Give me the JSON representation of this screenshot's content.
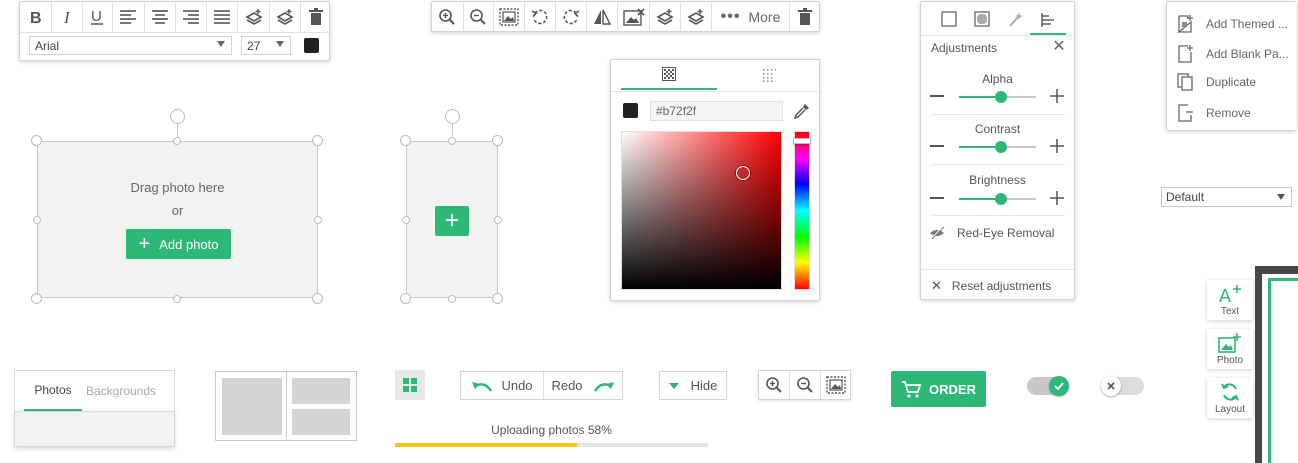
{
  "text_toolbar": {
    "font_family": "Arial",
    "font_size": "27",
    "text_color": "#222222"
  },
  "image_toolbar": {
    "more_label": "More"
  },
  "photo_placeholder": {
    "drag_text": "Drag photo here",
    "or_text": "or",
    "add_photo_label": "Add photo"
  },
  "color_picker": {
    "hex_value": "#b72f2f",
    "current_color": "#222222"
  },
  "adjustments": {
    "title": "Adjustments",
    "alpha_label": "Alpha",
    "contrast_label": "Contrast",
    "brightness_label": "Brightness",
    "alpha_value": 0.55,
    "contrast_value": 0.55,
    "brightness_value": 0.55,
    "red_eye_label": "Red-Eye Removal",
    "reset_label": "Reset adjustments"
  },
  "page_menu": {
    "items": [
      "Add Themed ...",
      "Add Blank Pa...",
      "Duplicate",
      "Remove"
    ]
  },
  "dropdown_default": "Default",
  "side_tools": {
    "text_label": "Text",
    "photo_label": "Photo",
    "layout_label": "Layout"
  },
  "tabs": {
    "photos_label": "Photos",
    "backgrounds_label": "Backgrounds"
  },
  "history": {
    "undo_label": "Undo",
    "redo_label": "Redo"
  },
  "hide_label": "Hide",
  "upload": {
    "text": "Uploading photos 58%",
    "progress": 0.58
  },
  "order_label": "ORDER",
  "colors": {
    "accent": "#2db878",
    "progress": "#f0c814"
  }
}
